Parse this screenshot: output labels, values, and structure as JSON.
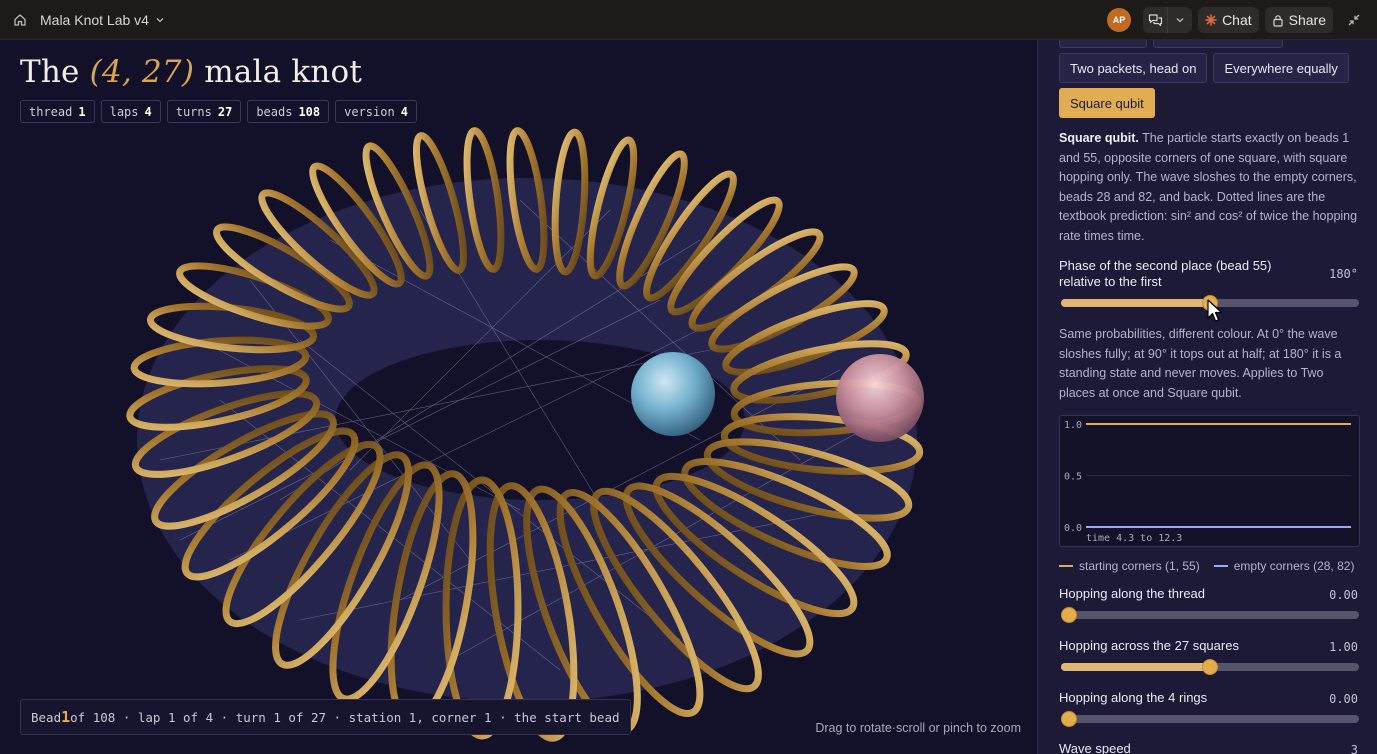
{
  "topbar": {
    "app_title": "Mala Knot Lab v4",
    "avatar_initials": "AP",
    "chat_label": "Chat",
    "share_label": "Share"
  },
  "knot": {
    "title_prefix": "The",
    "title_params": "(4, 27)",
    "title_suffix": "mala knot",
    "chips": [
      {
        "key": "thread",
        "value": "1"
      },
      {
        "key": "laps",
        "value": "4"
      },
      {
        "key": "turns",
        "value": "27"
      },
      {
        "key": "beads",
        "value": "108"
      },
      {
        "key": "version",
        "value": "4"
      }
    ],
    "status": {
      "prefix": "Bead",
      "bead": "1",
      "suffix": "of 108 · lap 1 of 4 · turn 1 of 27 · station 1, corner 1 · the start bead"
    },
    "hint": "Drag to rotate·scroll or pinch to zoom"
  },
  "panel": {
    "modes_row": [
      "Two packets, head on",
      "Everywhere equally"
    ],
    "active_mode": "Square qubit",
    "description_title": "Square qubit.",
    "description_body": "The particle starts exactly on beads 1 and 55, opposite corners of one square, with square hopping only. The wave sloshes to the empty corners, beads 28 and 82, and back. Dotted lines are the textbook prediction: sin² and cos² of twice the hopping rate times time.",
    "phase": {
      "label": "Phase of the second place (bead 55) relative to the first",
      "value_text": "180°",
      "fraction": 0.5
    },
    "phase_note": "Same probabilities, different colour. At 0° the wave sloshes fully; at 90° it tops out at half; at 180° it is a standing state and never moves. Applies to Two places at once and Square qubit.",
    "chart_data": {
      "type": "line",
      "y_ticks": [
        "1.0",
        "0.5",
        "0.0"
      ],
      "ylim": [
        0,
        1
      ],
      "x_range": [
        4.3,
        12.3
      ],
      "x_caption": "time 4.3 to 12.3",
      "series": [
        {
          "name": "starting corners (1, 55)",
          "color": "#e0ad52",
          "x": [
            4.3,
            12.3
          ],
          "y": [
            1.0,
            1.0
          ]
        },
        {
          "name": "empty corners (28, 82)",
          "color": "#9aa8ff",
          "x": [
            4.3,
            12.3
          ],
          "y": [
            0.0,
            0.0
          ]
        }
      ]
    },
    "sliders": [
      {
        "label": "Hopping along the thread",
        "value_text": "0.00",
        "fraction": 0.0
      },
      {
        "label": "Hopping across the 27 squares",
        "value_text": "1.00",
        "fraction": 0.5
      },
      {
        "label": "Hopping along the 4 rings",
        "value_text": "0.00",
        "fraction": 0.0
      },
      {
        "label": "Wave speed",
        "value_text": "3"
      }
    ]
  }
}
